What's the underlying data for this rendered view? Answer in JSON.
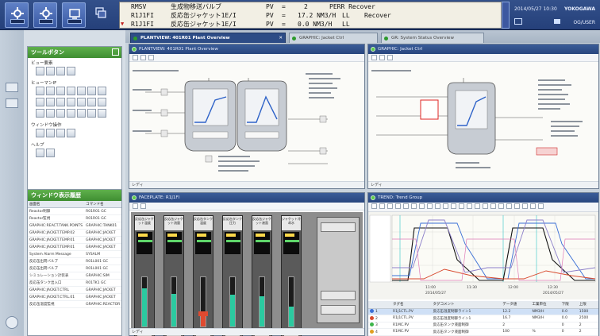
{
  "alarms": [
    {
      "tag": "RMSV",
      "desc": "生成物移送バルブ",
      "pv": "PV",
      "eq": "=",
      "value": "2",
      "type": "",
      "status": "PERR Recover",
      "marker": ""
    },
    {
      "tag": "R1J1FI",
      "desc": "反応缶ジャケット1E/I",
      "pv": "PV",
      "eq": "=",
      "value": "17.2 NM3/H",
      "type": "LL",
      "status": "Recover",
      "marker": ""
    },
    {
      "tag": "R1J1FI",
      "desc": "反応缶ジャケット1E/I",
      "pv": "PV",
      "eq": "=",
      "value": "0.0 NM3/H",
      "type": "LL",
      "status": "",
      "marker": "▼"
    }
  ],
  "header": {
    "datetime": "2014/05/27 10:30",
    "company": "YOKOGAWA",
    "user": "OG/USER"
  },
  "tabs": [
    {
      "label": "PLANTVIEW: 401R01 Plant Overview",
      "close": "✕"
    },
    {
      "label": "GRAPHIC: Jacket Ctrl",
      "close": ""
    },
    {
      "label": "GR: System Status Overview",
      "close": ""
    }
  ],
  "toolbox": {
    "title": "ツールボタン",
    "sections": [
      "ビュー要素",
      "ヒューマンIF",
      "ウィンドウ操作",
      "ヘルプ"
    ]
  },
  "winlist": {
    "title": "ウィンドウ表示履歴",
    "columns": [
      "画面名",
      "コマンド名"
    ],
    "rows": [
      [
        "Reactor制御",
        "R01R01 GC"
      ],
      [
        "Reactor監視",
        "R01R01 GC"
      ],
      [
        "GRAPHIC:REACT.TANK.POINTS",
        "GRAPHIC:TANK01"
      ],
      [
        "GRAPHIC:JACKET.TEMP.02",
        "GRAPHIC:JACKET"
      ],
      [
        "GRAPHIC:JACKET.TEMP.01",
        "GRAPHIC:JACKET"
      ],
      [
        "GRAPHIC:JACKET.TEMP.01",
        "GRAPHIC:JACKET"
      ],
      [
        "System Alarm Message",
        "SYSALM"
      ],
      [
        "反応缶出荷バルブ",
        "R01L001 GC"
      ],
      [
        "反応缶出荷バルブ",
        "R01L001 GC"
      ],
      [
        "シミュレーション計装表",
        "GRAPHIC:SIM"
      ],
      [
        "反応缶タンク出入口",
        "R01TK1 GC"
      ],
      [
        "GRAPHIC:JACKET.CTRL",
        "GRAPHIC:JACKET"
      ],
      [
        "GRAPHIC:JACKET.CTRL.01",
        "GRAPHIC:JACKET"
      ],
      [
        "反応缶温度監視",
        "GRAPHIC:REACTOR"
      ]
    ]
  },
  "windows": {
    "plant": {
      "title": "PLANTVIEW: 401R01 Plant Overview",
      "status": "レディ"
    },
    "detail": {
      "title": "GRAPHIC: Jacket Ctrl",
      "status": "レディ"
    },
    "faceplate": {
      "title": "FACEPLATE: R1J1FI",
      "status": "レディ"
    },
    "trend": {
      "title": "TREND: Trend Group",
      "status": "レディ"
    }
  },
  "faceplates": [
    {
      "name": "反応缶ジャケット温度",
      "level": 0.78,
      "bar_color": "#2bcaa0",
      "alarm": false
    },
    {
      "name": "反応缶ジャケット流量",
      "level": 0.66,
      "bar_color": "#2bcaa0",
      "alarm": false
    },
    {
      "name": "反応缶タンク温度",
      "level": 0.25,
      "bar_color": "#e04a30",
      "alarm": true
    },
    {
      "name": "反応缶タンク圧力",
      "level": 0.64,
      "bar_color": "#2bcaa0",
      "alarm": false
    },
    {
      "name": "反応缶ジャケット液面",
      "level": 0.62,
      "bar_color": "#2bcaa0",
      "alarm": false
    },
    {
      "name": "ジャケット冷却水",
      "level": 0.4,
      "bar_color": "#2bcaa0",
      "alarm": false
    }
  ],
  "trend_table": {
    "columns": [
      "タグ名",
      "タグコメント",
      "データ値",
      "工業単位",
      "下限",
      "上限"
    ],
    "rows": [
      {
        "no": "1",
        "tag": "R1J1CTL.PV",
        "comment": "反応缶温度制御ライン1",
        "value": "12.2",
        "unit": "NM3/H",
        "low": "0.0",
        "high": "1500",
        "color": "#3a6fd6"
      },
      {
        "no": "2",
        "tag": "R1J1CTL.PV",
        "comment": "反応缶温度制御ライン1",
        "value": "16.7",
        "unit": "NM3/H",
        "low": "0.0",
        "high": "2500",
        "color": "#d84a2e"
      },
      {
        "no": "3",
        "tag": "R1MC.PV",
        "comment": "反応缶タンク液面制御",
        "value": "2",
        "unit": "",
        "low": "0",
        "high": "2",
        "color": "#3db54a"
      },
      {
        "no": "4",
        "tag": "R1MC.PV",
        "comment": "反応缶タンク液面制御",
        "value": "100",
        "unit": "%",
        "low": "0",
        "high": "2",
        "color": "#e0a020"
      }
    ]
  },
  "trend_axis": {
    "xlabels": [
      "2014/05/27",
      "2014/05/27"
    ],
    "ticks": [
      "11:00",
      "11:30",
      "12:00",
      "12:30",
      "13:00"
    ]
  },
  "colors": {
    "header_bg": "#2a4680",
    "panel_green": "#4c9e3c",
    "trend_bg": "#f4f4f0"
  }
}
